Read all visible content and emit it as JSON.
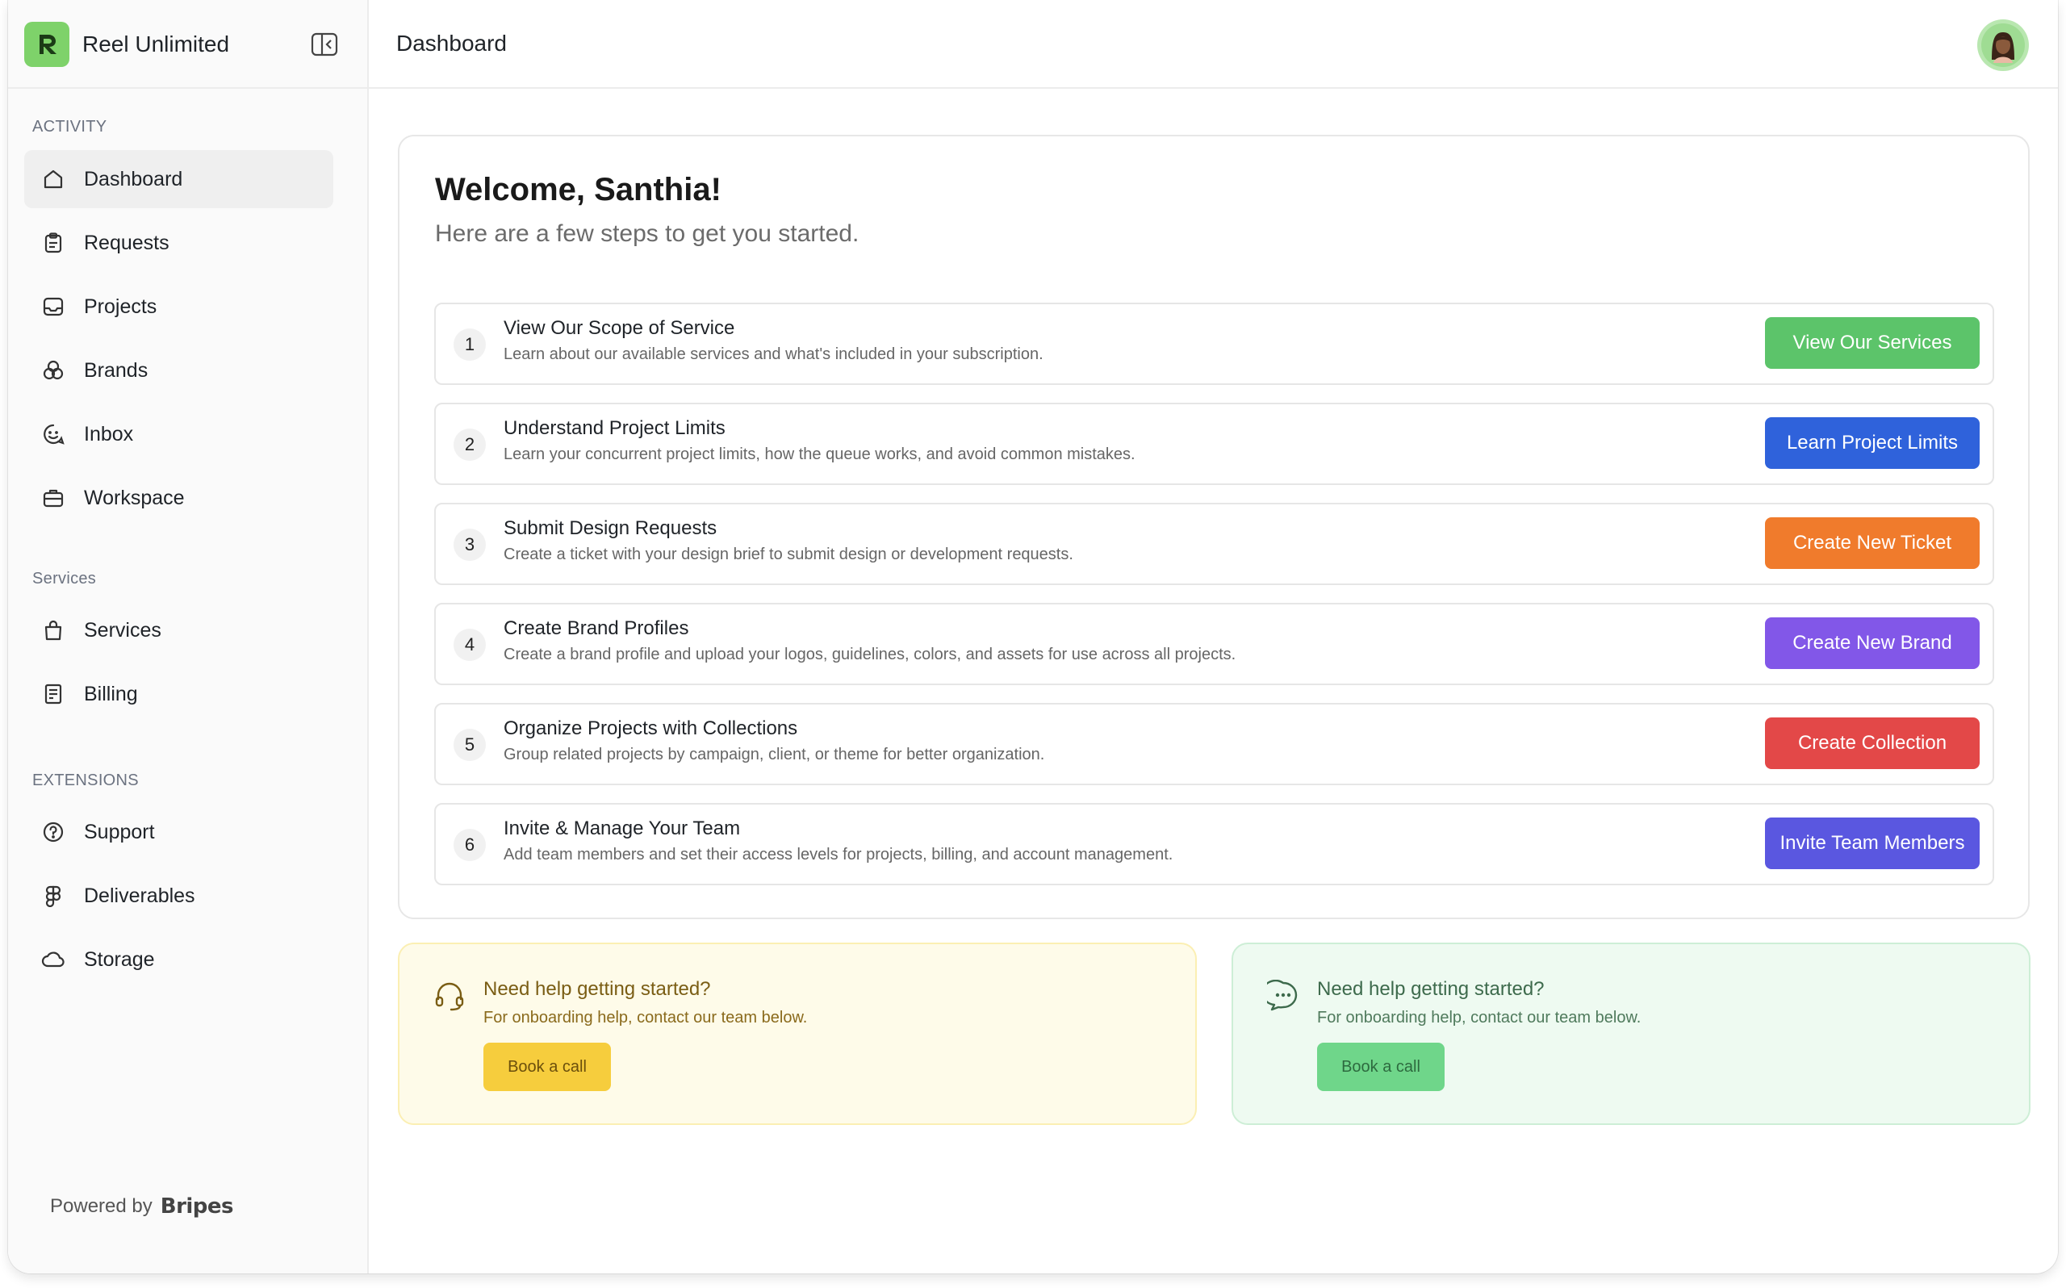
{
  "app": {
    "name": "Reel Unlimited",
    "brand_color": "#7ed26a"
  },
  "header": {
    "title": "Dashboard"
  },
  "sidebar": {
    "sections": [
      {
        "label": "ACTIVITY",
        "items": [
          {
            "label": "Dashboard",
            "icon": "home-icon",
            "active": true
          },
          {
            "label": "Requests",
            "icon": "clipboard-icon"
          },
          {
            "label": "Projects",
            "icon": "inbox-tray-icon"
          },
          {
            "label": "Brands",
            "icon": "brands-circles-icon"
          },
          {
            "label": "Inbox",
            "icon": "chat-smile-icon"
          },
          {
            "label": "Workspace",
            "icon": "briefcase-icon"
          }
        ]
      },
      {
        "label": "Services",
        "items": [
          {
            "label": "Services",
            "icon": "shopping-bag-icon"
          },
          {
            "label": "Billing",
            "icon": "receipt-icon"
          }
        ]
      },
      {
        "label": "EXTENSIONS",
        "items": [
          {
            "label": "Support",
            "icon": "help-circle-icon"
          },
          {
            "label": "Deliverables",
            "icon": "figma-icon"
          },
          {
            "label": "Storage",
            "icon": "cloud-icon"
          }
        ]
      }
    ],
    "footer": {
      "powered_by": "Powered by",
      "brand": "Bripes"
    }
  },
  "welcome": {
    "title": "Welcome, Santhia!",
    "subtitle": "Here are a few steps to get you started."
  },
  "steps": [
    {
      "number": "1",
      "title": "View Our Scope of Service",
      "description": "Learn about our available services and what's included in your subscription.",
      "button": "View Our Services",
      "color": "#5cc46a"
    },
    {
      "number": "2",
      "title": "Understand Project Limits",
      "description": "Learn your concurrent project limits, how the queue works, and avoid common mistakes.",
      "button": "Learn Project Limits",
      "color": "#2f62db"
    },
    {
      "number": "3",
      "title": "Submit Design Requests",
      "description": "Create a ticket with your design brief to submit design or development requests.",
      "button": "Create New Ticket",
      "color": "#f07b2c"
    },
    {
      "number": "4",
      "title": "Create Brand Profiles",
      "description": "Create a brand profile and upload your logos, guidelines, colors, and assets for use across all projects.",
      "button": "Create New Brand",
      "color": "#8257e8"
    },
    {
      "number": "5",
      "title": "Organize Projects with Collections",
      "description": "Group related projects by campaign, client, or theme for better organization.",
      "button": "Create Collection",
      "color": "#e34848"
    },
    {
      "number": "6",
      "title": "Invite & Manage Your Team",
      "description": "Add team members and set their access levels for projects, billing, and account management.",
      "button": "Invite Team Members",
      "color": "#5a57e0"
    }
  ],
  "help_cards": [
    {
      "title": "Need help getting started?",
      "description": "For onboarding help, contact our team below.",
      "button": "Book a call",
      "icon": "headset-icon"
    },
    {
      "title": "Need help getting started?",
      "description": "For onboarding help, contact our team below.",
      "button": "Book a call",
      "icon": "chat-bubble-icon"
    }
  ]
}
